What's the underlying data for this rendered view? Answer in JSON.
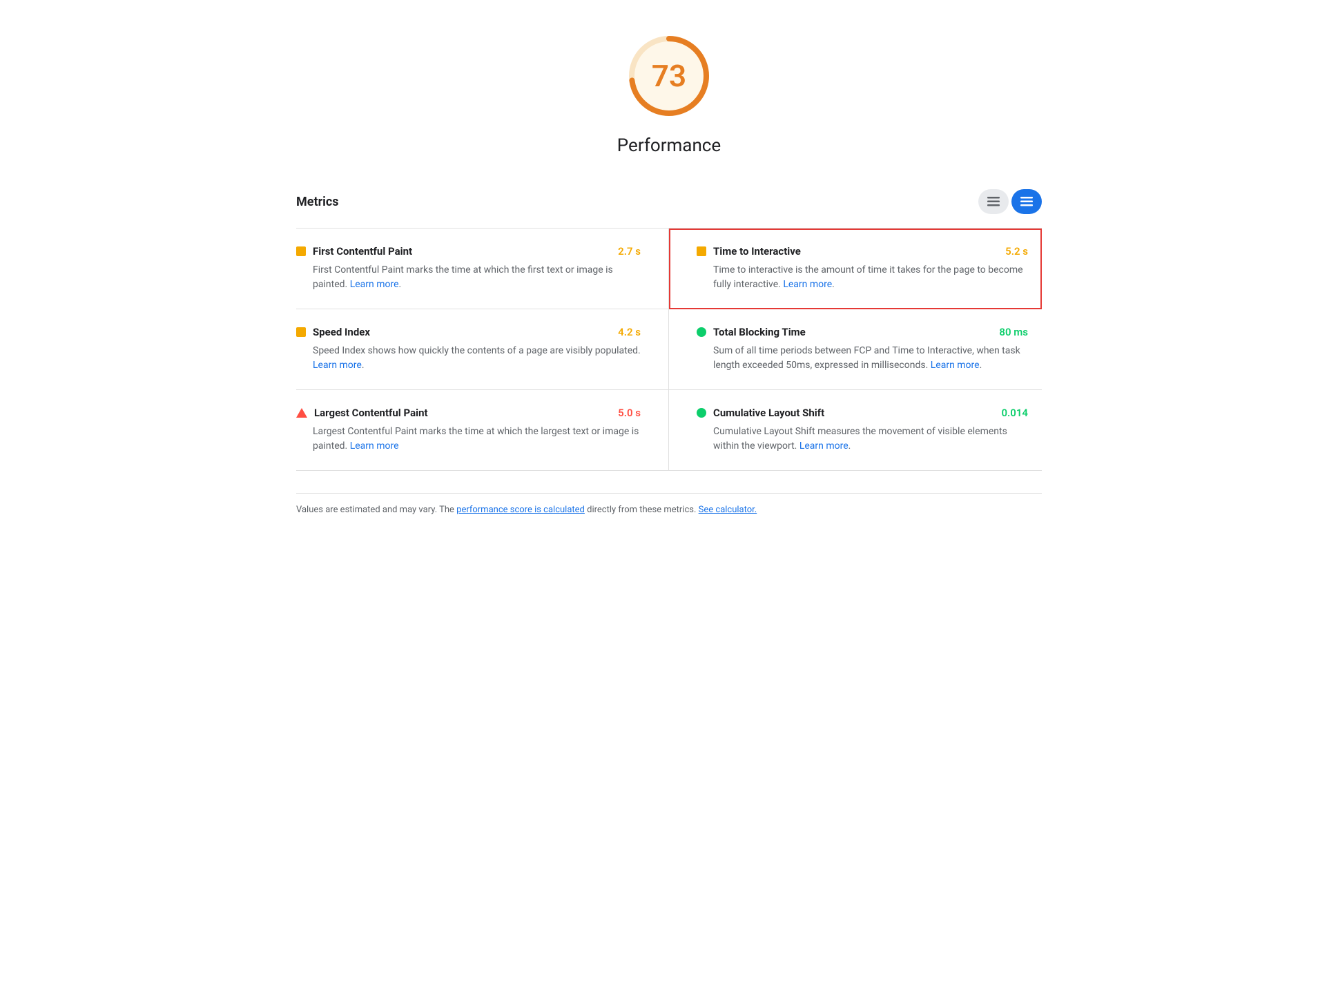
{
  "score": {
    "value": "73",
    "title": "Performance",
    "arc_color": "#e67e22",
    "arc_background": "#f9e4c4"
  },
  "metrics_section": {
    "label": "Metrics",
    "btn_list": "≡",
    "btn_detail": "≡"
  },
  "metrics": [
    {
      "id": "fcp",
      "name": "First Contentful Paint",
      "value": "2.7 s",
      "value_color": "value-orange",
      "icon_type": "orange-square",
      "description": "First Contentful Paint marks the time at which the first text or image is painted.",
      "learn_more_text": "Learn more",
      "learn_more_href": "#",
      "highlighted": false,
      "position": "left"
    },
    {
      "id": "tti",
      "name": "Time to Interactive",
      "value": "5.2 s",
      "value_color": "value-orange",
      "icon_type": "orange-square",
      "description": "Time to interactive is the amount of time it takes for the page to become fully interactive.",
      "learn_more_text": "Learn more",
      "learn_more_href": "#",
      "highlighted": true,
      "position": "right"
    },
    {
      "id": "si",
      "name": "Speed Index",
      "value": "4.2 s",
      "value_color": "value-orange",
      "icon_type": "orange-square",
      "description": "Speed Index shows how quickly the contents of a page are visibly populated.",
      "learn_more_text": "Learn more",
      "learn_more_href": "#",
      "highlighted": false,
      "position": "left"
    },
    {
      "id": "tbt",
      "name": "Total Blocking Time",
      "value": "80 ms",
      "value_color": "value-green",
      "icon_type": "green-circle",
      "description": "Sum of all time periods between FCP and Time to Interactive, when task length exceeded 50ms, expressed in milliseconds.",
      "learn_more_text": "Learn more",
      "learn_more_href": "#",
      "highlighted": false,
      "position": "right"
    },
    {
      "id": "lcp",
      "name": "Largest Contentful Paint",
      "value": "5.0 s",
      "value_color": "value-red",
      "icon_type": "red-triangle",
      "description": "Largest Contentful Paint marks the time at which the largest text or image is painted.",
      "learn_more_text": "Learn more",
      "learn_more_href": "#",
      "highlighted": false,
      "position": "left"
    },
    {
      "id": "cls",
      "name": "Cumulative Layout Shift",
      "value": "0.014",
      "value_color": "value-green",
      "icon_type": "green-circle",
      "description": "Cumulative Layout Shift measures the movement of visible elements within the viewport.",
      "learn_more_text": "Learn more",
      "learn_more_href": "#",
      "highlighted": false,
      "position": "right"
    }
  ],
  "footer": {
    "text_before": "Values are estimated and may vary. The ",
    "link1_text": "performance score is calculated",
    "text_middle": " directly from these metrics. ",
    "link2_text": "See calculator.",
    "link1_href": "#",
    "link2_href": "#"
  }
}
